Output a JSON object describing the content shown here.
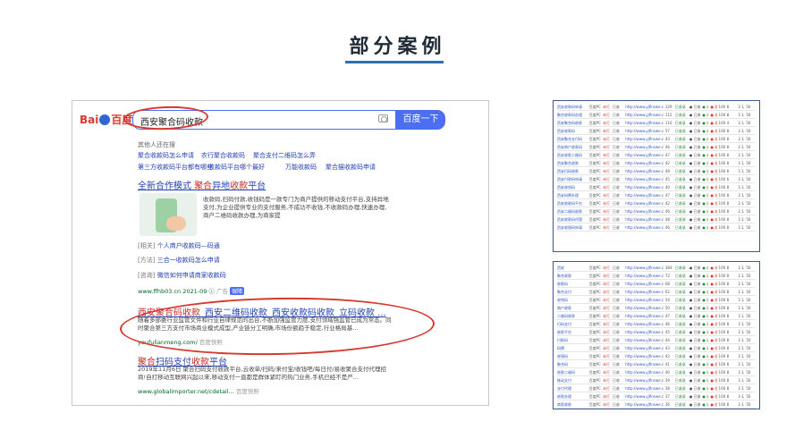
{
  "page_title": "部分案例",
  "search": {
    "logo_text_left": "Bai",
    "logo_text_right": "百度",
    "query": "西安聚合码收款",
    "button_label": "百度一下"
  },
  "related": {
    "heading": "其他人还在搜",
    "items": [
      "聚合收款码怎么申请",
      "农行聚合收款码",
      "聚合支付二维码怎么弄",
      "第三方收款码平台都有哪些",
      "收款码平台哪个最好",
      "万能收款码",
      "聚合猫收款码申请"
    ]
  },
  "results": [
    {
      "title_parts": [
        "全新合作模式 ",
        "聚合",
        "异地",
        "收款",
        "平台"
      ],
      "desc_lines": [
        "收款码,扫码付款,收钱码是一款专门为商户提供的移动支付平台,支持异地",
        "支付,为企业提供专业的支付服务,不成功不收钱,不收款码办理,快速办理,",
        "商户二维码收款办理,为商家提"
      ],
      "subs": [
        {
          "tag": "[相关]",
          "text": "个人商户收款码—码通"
        },
        {
          "tag": "[方法]",
          "text": "三合一收款码怎么申请"
        },
        {
          "tag": "[咨询]",
          "text": "微信如何申请商家收款码"
        }
      ],
      "url": "www.ffhb03.cn 2021-09",
      "ad": "广告",
      "ad_badge": "保障"
    },
    {
      "title_parts": [
        "西安聚合码收款",
        "_西安二维码收款_西安收款码收款_立码收款 ..."
      ],
      "desc_lines": [
        "随着多部委行业监管文件和行业自律规范的出台,不断加强监管力度,支付领域强监管已成为常态。同",
        "时聚合第三方支付市场商业模式成型,产业链分工明确,市场份额趋于稳定,行业格局基..."
      ],
      "url": "youfulianmeng.com/",
      "snap": "百度快照"
    },
    {
      "title_parts": [
        "聚合",
        "扫码支付",
        "收款",
        "平台"
      ],
      "desc_lines": [
        "2019年11月6日 聚合扫码支付收款平台,云收单/扫码/来付宝/收钱吧/每日付/易收聚合支付代理招",
        "商!自打移动互联网兴起以来,移动支付一直都是群体紧盯的热门业务,手机已经不是严..."
      ],
      "url": "www.globalimporter.net/cdetail...",
      "snap": "百度快照"
    }
  ],
  "table_top": {
    "rows": [
      [
        "西安收款码申请",
        "百度PC",
        "未打",
        "已收",
        "http://www.yjfinswe.com/",
        "129",
        "已收录",
        "● 已收录",
        "● 收",
        "● 收",
        "100",
        "8",
        "3 1/1",
        "50"
      ],
      [
        "聚合收款码办理",
        "百度PC",
        "未打",
        "已收",
        "http://www.yjfinswe.com/",
        "115",
        "已收录",
        "● 已收录",
        "● 收",
        "● 收",
        "100",
        "8",
        "3 1/1",
        "50"
      ],
      [
        "西安聚合码收款",
        "百度PC",
        "未打",
        "已收",
        "http://www.yjfinswe.com/",
        "116",
        "已收录",
        "● 已收录",
        "● 收",
        "● 收",
        "100",
        "4",
        "3 1/1",
        "50"
      ],
      [
        "西安收款码",
        "百度PC",
        "未打",
        "已收",
        "http://www.yjfinswe.com/",
        "57",
        "已收录",
        "● 已收录",
        "● 收",
        "● 收",
        "100",
        "8",
        "3 1/1",
        "50"
      ],
      [
        "西安聚合支付码",
        "百度PC",
        "未打",
        "已收",
        "http://www.yjfinswe.com/",
        "43",
        "已收录",
        "● 已收录",
        "● 收",
        "● 收",
        "100",
        "8",
        "3 1/1",
        "50"
      ],
      [
        "西安商户收款码",
        "百度PC",
        "未打",
        "已收",
        "http://www.yjfinswe.com/",
        "46",
        "已收录",
        "● 已收录",
        "● 收",
        "● 收",
        "100",
        "8",
        "3 1/1",
        "50"
      ],
      [
        "西安收款二维码",
        "百度PC",
        "未打",
        "已收",
        "http://www.yjfinswe.com/",
        "47",
        "已收录",
        "● 已收录",
        "● 收",
        "● 收",
        "100",
        "8",
        "3 1/1",
        "50"
      ],
      [
        "西安聚合收款",
        "百度PC",
        "未打",
        "已收",
        "http://www.yjfinswe.com/",
        "42",
        "已收录",
        "● 已收录",
        "● 收",
        "● 收",
        "100",
        "8",
        "3 1/1",
        "50"
      ],
      [
        "西安扫码收款",
        "百度PC",
        "未打",
        "已收",
        "http://www.yjfinswe.com/",
        "48",
        "已收录",
        "● 已收录",
        "● 收",
        "● 收",
        "100",
        "8",
        "3 1/1",
        "50"
      ],
      [
        "西安付款码申请",
        "百度PC",
        "未打",
        "已收",
        "http://www.yjfinswe.com/",
        "45",
        "已收录",
        "● 已收录",
        "● 收",
        "● 收",
        "100",
        "6",
        "3 1/1",
        "50"
      ],
      [
        "西安收钱码",
        "百度PC",
        "未打",
        "已收",
        "http://www.yjfinswe.com/",
        "40",
        "已收录",
        "● 已收录",
        "● 收",
        "● 收",
        "100",
        "8",
        "3 1/1",
        "50"
      ],
      [
        "西安码牌办理",
        "百度PC",
        "未打",
        "已收",
        "http://www.yjfinswe.com/",
        "47",
        "已收录",
        "● 已收录",
        "● 收",
        "● 收",
        "100",
        "8",
        "3 1/1",
        "50"
      ],
      [
        "西安收款码平台",
        "百度PC",
        "未打",
        "已收",
        "http://www.yjfinswe.com/",
        "42",
        "已收录",
        "● 已收录",
        "● 收",
        "● 收",
        "100",
        "8",
        "3 1/1",
        "50"
      ],
      [
        "西安二维码收款",
        "百度PC",
        "未打",
        "已收",
        "http://www.yjfinswe.com/",
        "46",
        "已收录",
        "● 已收录",
        "● 收",
        "● 收",
        "100",
        "8",
        "3 1/1",
        "50"
      ],
      [
        "西安收款码代理",
        "百度PC",
        "未打",
        "已收",
        "http://www.yjfinswe.com/",
        "48",
        "已收录",
        "● 已收录",
        "● 收",
        "● 收",
        "100",
        "8",
        "3 1/1",
        "50"
      ],
      [
        "西安收银码申请",
        "百度PC",
        "未打",
        "已收",
        "http://www.yjfinswe.com/",
        "46",
        "已收录",
        "● 已收录",
        "● 收",
        "● 收",
        "100",
        "8",
        "3 1/1",
        "50"
      ]
    ]
  },
  "table_bottom": {
    "rows": [
      [
        "西安",
        "百度PC",
        "未打",
        "已收",
        "http://www.yjfinswe.com/",
        "384",
        "已收录",
        "● 已收录",
        "● 收",
        "● 收",
        "100",
        "8",
        "3 1/1",
        "50"
      ],
      [
        "聚合收款",
        "百度PC",
        "未打",
        "已收",
        "http://www.yjfinswe.com/",
        "72",
        "已收录",
        "● 已收录",
        "● 收",
        "● 收",
        "100",
        "8",
        "3 1/1",
        "50"
      ],
      [
        "收款码",
        "百度PC",
        "未打",
        "已收",
        "http://www.yjfinswe.com/",
        "68",
        "已收录",
        "● 已收录",
        "● 收",
        "● 收",
        "100",
        "8",
        "3 1/1",
        "50"
      ],
      [
        "聚合支付",
        "百度PC",
        "未打",
        "已收",
        "http://www.yjfinswe.com/",
        "62",
        "已收录",
        "● 已收录",
        "● 收",
        "● 收",
        "100",
        "8",
        "3 1/1",
        "50"
      ],
      [
        "收钱码",
        "百度PC",
        "未打",
        "已收",
        "http://www.yjfinswe.com/",
        "54",
        "已收录",
        "● 已收录",
        "● 收",
        "● 收",
        "100",
        "8",
        "3 1/1",
        "50"
      ],
      [
        "商户收款",
        "百度PC",
        "未打",
        "已收",
        "http://www.yjfinswe.com/",
        "50",
        "已收录",
        "● 已收录",
        "● 收",
        "● 收",
        "100",
        "8",
        "3 1/1",
        "50"
      ],
      [
        "二维码收款",
        "百度PC",
        "未打",
        "已收",
        "http://www.yjfinswe.com/",
        "47",
        "已收录",
        "● 已收录",
        "● 收",
        "● 收",
        "100",
        "8",
        "3 1/1",
        "50"
      ],
      [
        "扫码支付",
        "百度PC",
        "未打",
        "已收",
        "http://www.yjfinswe.com/",
        "46",
        "已收录",
        "● 已收录",
        "● 收",
        "● 收",
        "100",
        "8",
        "3 1/1",
        "50"
      ],
      [
        "收款平台",
        "百度PC",
        "未打",
        "已收",
        "http://www.yjfinswe.com/",
        "45",
        "已收录",
        "● 已收录",
        "● 收",
        "● 收",
        "100",
        "8",
        "3 1/1",
        "50"
      ],
      [
        "付款码",
        "百度PC",
        "未打",
        "已收",
        "http://www.yjfinswe.com/",
        "44",
        "已收录",
        "● 已收录",
        "● 收",
        "● 收",
        "100",
        "8",
        "3 1/1",
        "50"
      ],
      [
        "码牌",
        "百度PC",
        "未打",
        "已收",
        "http://www.yjfinswe.com/",
        "43",
        "已收录",
        "● 已收录",
        "● 收",
        "● 收",
        "100",
        "8",
        "3 1/1",
        "50"
      ],
      [
        "收银码",
        "百度PC",
        "未打",
        "已收",
        "http://www.yjfinswe.com/",
        "42",
        "已收录",
        "● 已收录",
        "● 收",
        "● 收",
        "100",
        "8",
        "3 1/1",
        "50"
      ],
      [
        "聚合码",
        "百度PC",
        "未打",
        "已收",
        "http://www.yjfinswe.com/",
        "41",
        "已收录",
        "● 已收录",
        "● 收",
        "● 收",
        "100",
        "8",
        "3 1/1",
        "50"
      ],
      [
        "收款二维码",
        "百度PC",
        "未打",
        "已收",
        "http://www.yjfinswe.com/",
        "40",
        "已收录",
        "● 已收录",
        "● 收",
        "● 收",
        "100",
        "8",
        "3 1/1",
        "50"
      ],
      [
        "移动支付",
        "百度PC",
        "未打",
        "已收",
        "http://www.yjfinswe.com/",
        "39",
        "已收录",
        "● 已收录",
        "● 收",
        "● 收",
        "100",
        "8",
        "3 1/1",
        "50"
      ],
      [
        "支付代理",
        "百度PC",
        "未打",
        "已收",
        "http://www.yjfinswe.com/",
        "38",
        "已收录",
        "● 已收录",
        "● 收",
        "● 收",
        "100",
        "8",
        "3 1/1",
        "50"
      ],
      [
        "收款办理",
        "百度PC",
        "未打",
        "已收",
        "http://www.yjfinswe.com/",
        "37",
        "已收录",
        "● 已收录",
        "● 收",
        "● 收",
        "100",
        "8",
        "3 1/1",
        "50"
      ],
      [
        "商家收款",
        "百度PC",
        "未打",
        "已收",
        "http://www.yjfinswe.com/",
        "36",
        "已收录",
        "● 已收录",
        "● 收",
        "● 收",
        "100",
        "8",
        "3 1/1",
        "50"
      ]
    ]
  }
}
